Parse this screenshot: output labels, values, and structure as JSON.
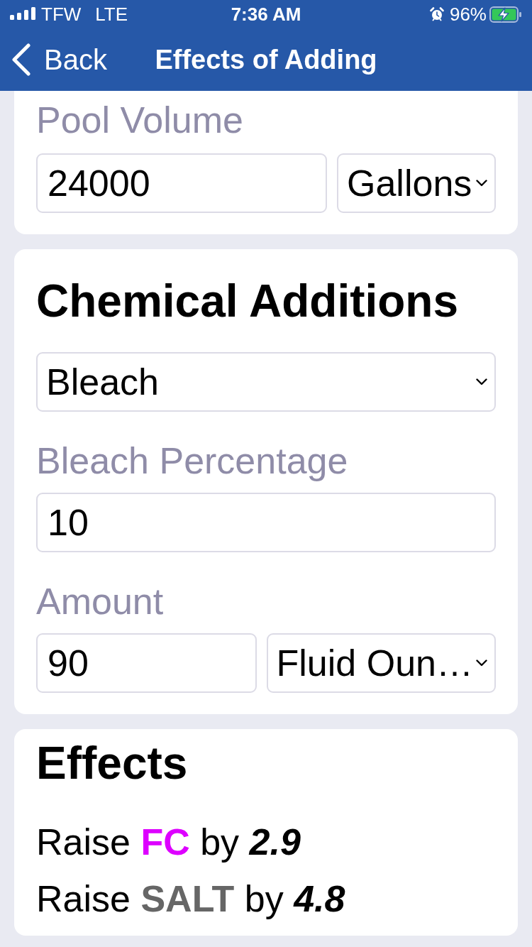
{
  "status_bar": {
    "carrier": "TFW",
    "network": "LTE",
    "time": "7:36 AM",
    "battery": "96%",
    "charging": true
  },
  "nav_bar": {
    "back_label": "Back",
    "title": "Effects of Adding"
  },
  "pool_volume": {
    "label": "Pool Volume",
    "value": "24000",
    "unit": "Gallons"
  },
  "chemical_additions": {
    "title": "Chemical Additions",
    "chemical": "Bleach",
    "fields": [
      {
        "label": "Bleach Percentage",
        "value": "10"
      },
      {
        "label": "Amount",
        "value": "90",
        "unit": "Fluid Oun…"
      }
    ]
  },
  "effects": {
    "title": "Effects",
    "items": [
      {
        "verb": "Raise",
        "chemical": "FC",
        "color": "#dd00ff",
        "preposition": "by",
        "amount": "2.9"
      },
      {
        "verb": "Raise",
        "chemical": "SALT",
        "color": "#666666",
        "preposition": "by",
        "amount": "4.8"
      }
    ]
  }
}
